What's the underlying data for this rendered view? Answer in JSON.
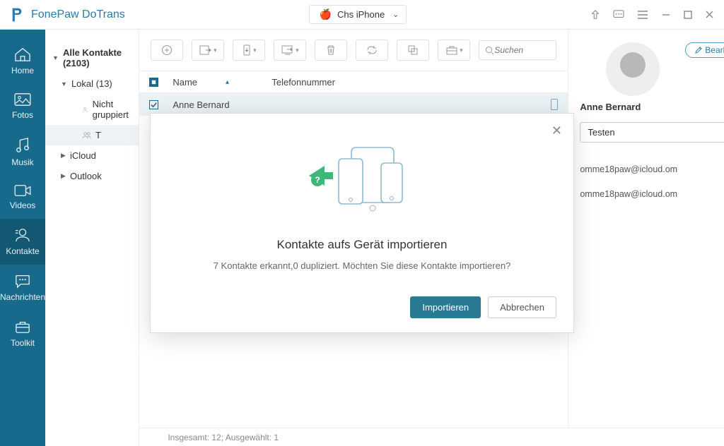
{
  "titlebar": {
    "brand": "FonePaw DoTrans",
    "device": "Chs iPhone"
  },
  "sidebar": [
    {
      "label": "Home"
    },
    {
      "label": "Fotos"
    },
    {
      "label": "Musik"
    },
    {
      "label": "Videos"
    },
    {
      "label": "Kontakte"
    },
    {
      "label": "Nachrichten"
    },
    {
      "label": "Toolkit"
    }
  ],
  "tree": {
    "all": "Alle Kontakte  (2103)",
    "local": "Lokal  (13)",
    "ungrouped": "Nicht gruppiert",
    "t": "T",
    "icloud": "iCloud",
    "outlook": "Outlook"
  },
  "search": {
    "placeholder": "Suchen"
  },
  "table": {
    "col_name": "Name",
    "col_phone": "Telefonnummer",
    "row_name": "Anne Bernard"
  },
  "detail": {
    "edit": "Bearbeiten",
    "name": "Anne Bernard",
    "group": "Testen",
    "email1": "omme18paw@icloud.om",
    "email2": "omme18paw@icloud.om"
  },
  "footer": "Insgesamt: 12; Ausgewählt: 1",
  "modal": {
    "title": "Kontakte aufs Gerät importieren",
    "desc": "7 Kontakte erkannt,0 dupliziert. Möchten Sie diese Kontakte importieren?",
    "import": "Importieren",
    "cancel": "Abbrechen"
  }
}
